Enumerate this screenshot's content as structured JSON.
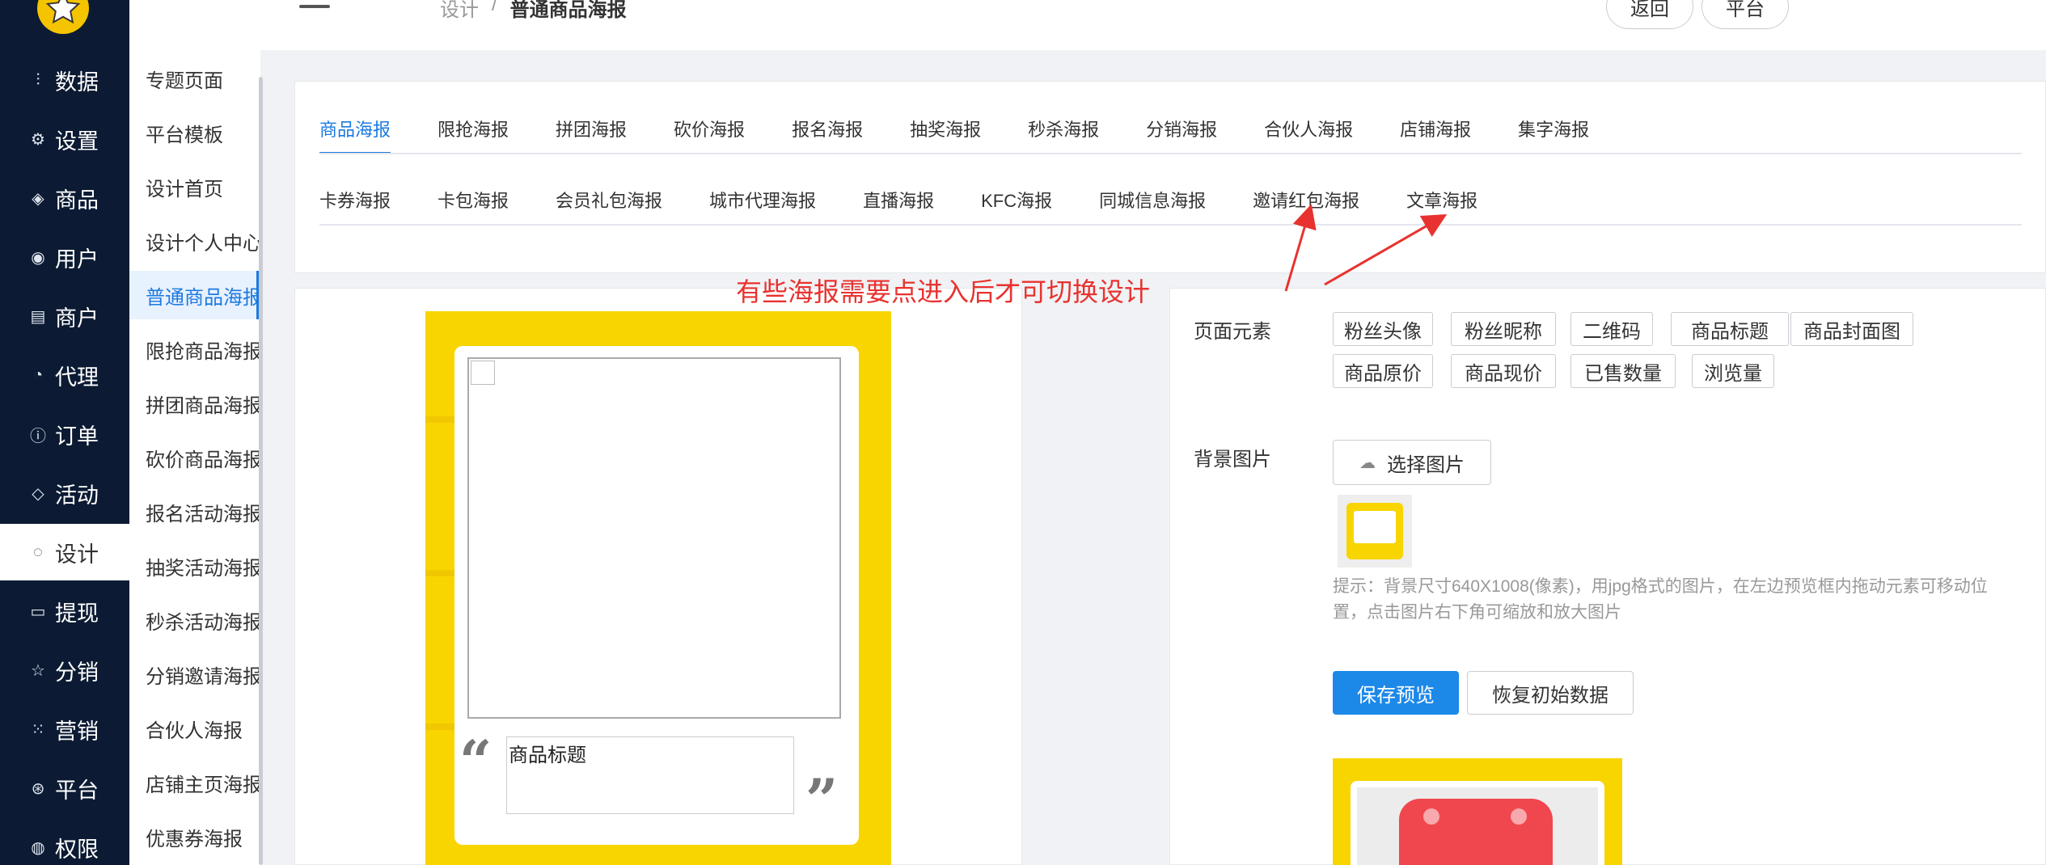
{
  "nav": {
    "items": [
      {
        "label": "数据",
        "icon": "chart-icon"
      },
      {
        "label": "设置",
        "icon": "gear-icon"
      },
      {
        "label": "商品",
        "icon": "box-icon"
      },
      {
        "label": "用户",
        "icon": "user-icon"
      },
      {
        "label": "商户",
        "icon": "list-icon"
      },
      {
        "label": "代理",
        "icon": "clock-icon"
      },
      {
        "label": "订单",
        "icon": "info-icon"
      },
      {
        "label": "活动",
        "icon": "tag-icon"
      },
      {
        "label": "设计",
        "icon": "palette-icon"
      },
      {
        "label": "提现",
        "icon": "card-icon"
      },
      {
        "label": "分销",
        "icon": "star-icon"
      },
      {
        "label": "营销",
        "icon": "grid-icon"
      },
      {
        "label": "平台",
        "icon": "globe-icon"
      },
      {
        "label": "权限",
        "icon": "shield-icon"
      }
    ],
    "active_index": 8
  },
  "subnav": {
    "items": [
      "专题页面",
      "平台模板",
      "设计首页",
      "设计个人中心",
      "普通商品海报",
      "限抢商品海报",
      "拼团商品海报",
      "砍价商品海报",
      "报名活动海报",
      "抽奖活动海报",
      "秒杀活动海报",
      "分销邀请海报",
      "合伙人海报",
      "店铺主页海报",
      "优惠券海报"
    ],
    "active_index": 4
  },
  "header": {
    "breadcrumb_parent": "设计",
    "breadcrumb_sep": "/",
    "breadcrumb_current": "普通商品海报",
    "back_label": "返回",
    "platform_label": "平台"
  },
  "tabs": {
    "row1": [
      "商品海报",
      "限抢海报",
      "拼团海报",
      "砍价海报",
      "报名海报",
      "抽奖海报",
      "秒杀海报",
      "分销海报",
      "合伙人海报",
      "店铺海报",
      "集字海报"
    ],
    "row2": [
      "卡券海报",
      "卡包海报",
      "会员礼包海报",
      "城市代理海报",
      "直播海报",
      "KFC海报",
      "同城信息海报",
      "邀请红包海报",
      "文章海报"
    ],
    "active": "商品海报"
  },
  "annotation": "有些海报需要点进入后才可切换设计",
  "preview": {
    "title_text": "商品标题",
    "open_quote": "“",
    "close_quote": "”"
  },
  "settings": {
    "elements_label": "页面元素",
    "elements": [
      "粉丝头像",
      "粉丝昵称",
      "二维码",
      "商品标题",
      "商品封面图",
      "商品原价",
      "商品现价",
      "已售数量",
      "浏览量"
    ],
    "bg_label": "背景图片",
    "select_image_label": "选择图片",
    "hint": "提示：背景尺寸640X1008(像素)，用jpg格式的图片，在左边预览框内拖动元素可移动位置，点击图片右下角可缩放和放大图片",
    "save_label": "保存预览",
    "reset_label": "恢复初始数据"
  },
  "colors": {
    "nav_bg": "#0c1b33",
    "accent": "#1c7ae0",
    "poster_yellow": "#f9d500",
    "annotation_red": "#e8322f"
  }
}
